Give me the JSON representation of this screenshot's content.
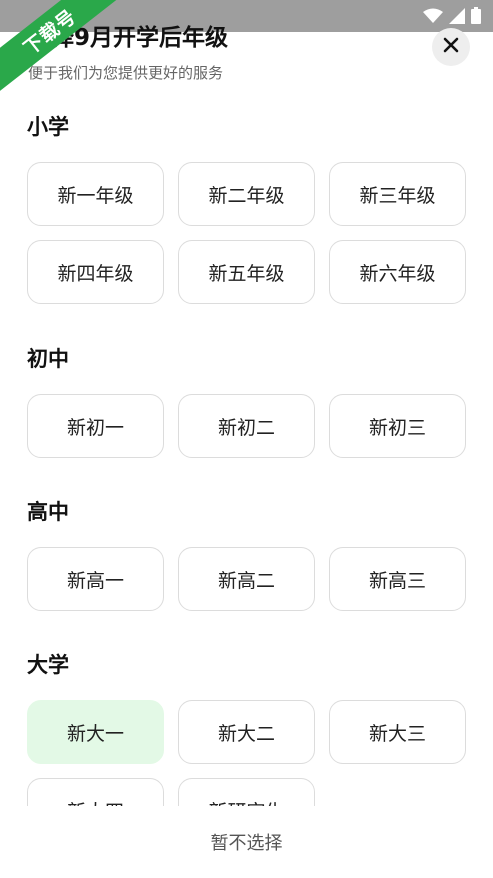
{
  "watermark": {
    "text": "下载号"
  },
  "header": {
    "title": "选择9月开学后年级",
    "subtitle": "便于我们为您提供更好的服务"
  },
  "sections": [
    {
      "title": "小学",
      "grades": [
        "新一年级",
        "新二年级",
        "新三年级",
        "新四年级",
        "新五年级",
        "新六年级"
      ]
    },
    {
      "title": "初中",
      "grades": [
        "新初一",
        "新初二",
        "新初三"
      ]
    },
    {
      "title": "高中",
      "grades": [
        "新高一",
        "新高二",
        "新高三"
      ]
    },
    {
      "title": "大学",
      "grades": [
        "新大一",
        "新大二",
        "新大三",
        "新大四",
        "新研究生"
      ]
    }
  ],
  "selected_grade": "新大一",
  "bottom": {
    "skip_label": "暂不选择"
  },
  "colors": {
    "selected_bg": "#e3f9e6",
    "watermark": "#2aa84a",
    "status_bar": "#9e9e9e"
  }
}
